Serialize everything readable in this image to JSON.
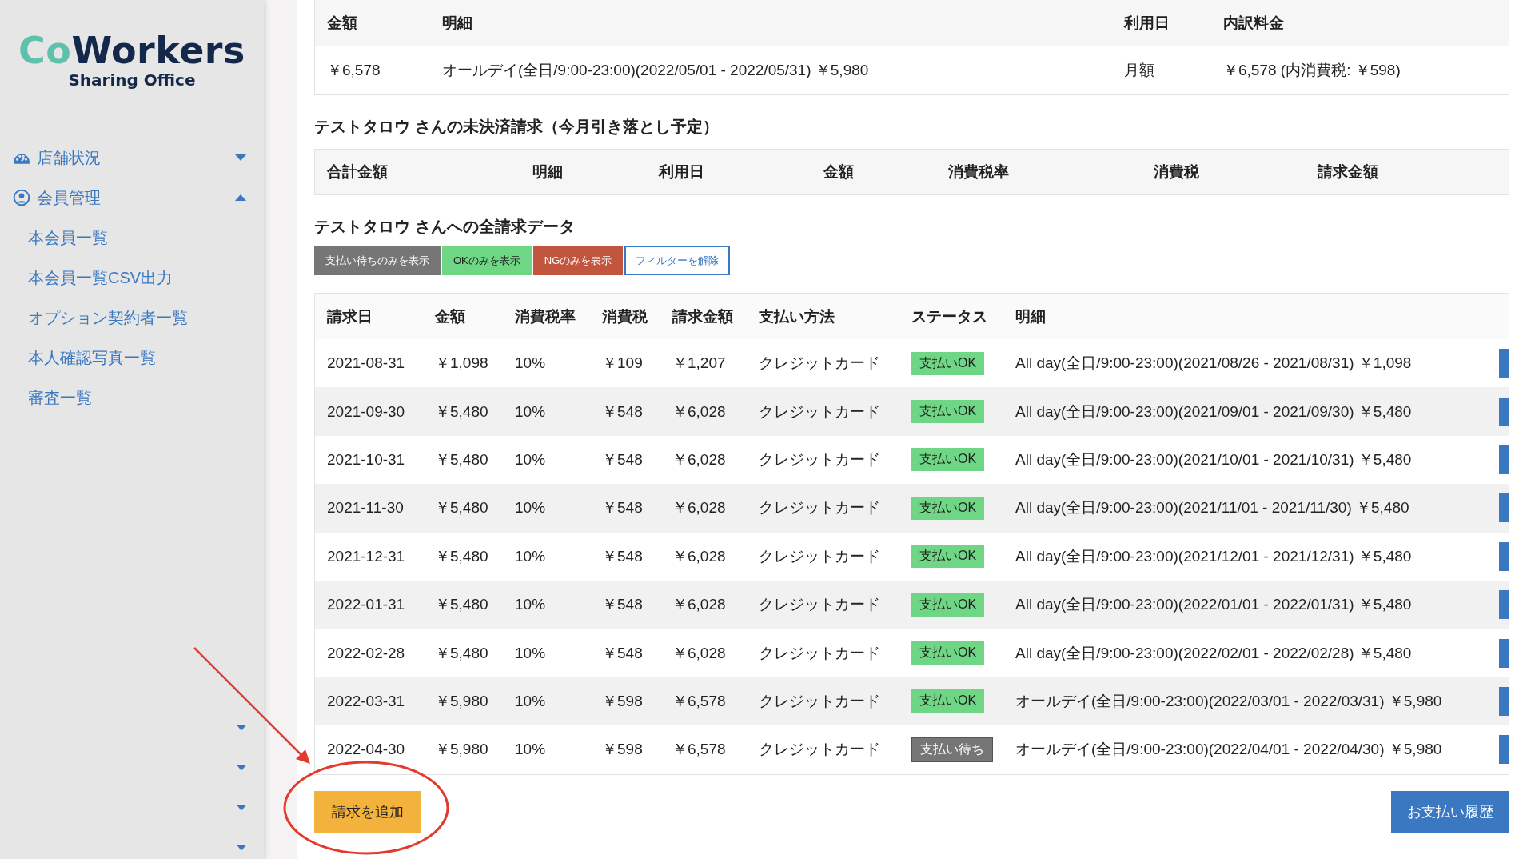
{
  "sidebar": {
    "logo": {
      "part_1": "Co",
      "part_2": "Workers",
      "subtitle": "Sharing Office"
    },
    "menus": [
      {
        "label": "店舗状況",
        "expanded": false
      },
      {
        "label": "会員管理",
        "expanded": true,
        "items": [
          "本会員一覧",
          "本会員一覧CSV出力",
          "オプション契約者一覧",
          "本人確認写真一覧",
          "審査一覧"
        ]
      }
    ]
  },
  "plan_table": {
    "columns": [
      "金額",
      "明細",
      "利用日",
      "内訳料金"
    ],
    "rows": [
      [
        "￥6,578",
        "オールデイ(全日/9:00-23:00)(2022/05/01 - 2022/05/31) ￥5,980",
        "月額",
        "￥6,578 (内消費税: ￥598)"
      ]
    ]
  },
  "unpaid_section": {
    "title": "テストタロウ さんの未決済請求（今月引き落とし予定）",
    "columns": [
      "合計金額",
      "明細",
      "利用日",
      "金額",
      "消費税率",
      "消費税",
      "請求金額"
    ]
  },
  "billing_section": {
    "title": "テストタロウ さんへの全請求データ",
    "filters": [
      {
        "label": "支払い待ちのみを表示",
        "kind": "pending"
      },
      {
        "label": "OKのみを表示",
        "kind": "ok"
      },
      {
        "label": "NGのみを表示",
        "kind": "ng"
      },
      {
        "label": "フィルターを解除",
        "kind": "clear"
      }
    ],
    "columns": [
      "請求日",
      "金額",
      "消費税率",
      "消費税",
      "請求金額",
      "支払い方法",
      "ステータス",
      "明細"
    ],
    "rows": [
      {
        "date": "2021-08-31",
        "amount": "￥1,098",
        "tax_rate": "10%",
        "tax": "￥109",
        "total": "￥1,207",
        "method": "クレジットカード",
        "status": "支払いOK",
        "kind": "ok",
        "detail": "All day(全日/9:00-23:00)(2021/08/26 - 2021/08/31) ￥1,098"
      },
      {
        "date": "2021-09-30",
        "amount": "￥5,480",
        "tax_rate": "10%",
        "tax": "￥548",
        "total": "￥6,028",
        "method": "クレジットカード",
        "status": "支払いOK",
        "kind": "ok",
        "detail": "All day(全日/9:00-23:00)(2021/09/01 - 2021/09/30) ￥5,480"
      },
      {
        "date": "2021-10-31",
        "amount": "￥5,480",
        "tax_rate": "10%",
        "tax": "￥548",
        "total": "￥6,028",
        "method": "クレジットカード",
        "status": "支払いOK",
        "kind": "ok",
        "detail": "All day(全日/9:00-23:00)(2021/10/01 - 2021/10/31) ￥5,480"
      },
      {
        "date": "2021-11-30",
        "amount": "￥5,480",
        "tax_rate": "10%",
        "tax": "￥548",
        "total": "￥6,028",
        "method": "クレジットカード",
        "status": "支払いOK",
        "kind": "ok",
        "detail": "All day(全日/9:00-23:00)(2021/11/01 - 2021/11/30) ￥5,480"
      },
      {
        "date": "2021-12-31",
        "amount": "￥5,480",
        "tax_rate": "10%",
        "tax": "￥548",
        "total": "￥6,028",
        "method": "クレジットカード",
        "status": "支払いOK",
        "kind": "ok",
        "detail": "All day(全日/9:00-23:00)(2021/12/01 - 2021/12/31) ￥5,480"
      },
      {
        "date": "2022-01-31",
        "amount": "￥5,480",
        "tax_rate": "10%",
        "tax": "￥548",
        "total": "￥6,028",
        "method": "クレジットカード",
        "status": "支払いOK",
        "kind": "ok",
        "detail": "All day(全日/9:00-23:00)(2022/01/01 - 2022/01/31) ￥5,480"
      },
      {
        "date": "2022-02-28",
        "amount": "￥5,480",
        "tax_rate": "10%",
        "tax": "￥548",
        "total": "￥6,028",
        "method": "クレジットカード",
        "status": "支払いOK",
        "kind": "ok",
        "detail": "All day(全日/9:00-23:00)(2022/02/01 - 2022/02/28) ￥5,480"
      },
      {
        "date": "2022-03-31",
        "amount": "￥5,980",
        "tax_rate": "10%",
        "tax": "￥598",
        "total": "￥6,578",
        "method": "クレジットカード",
        "status": "支払いOK",
        "kind": "ok",
        "detail": "オールデイ(全日/9:00-23:00)(2022/03/01 - 2022/03/31) ￥5,980"
      },
      {
        "date": "2022-04-30",
        "amount": "￥5,980",
        "tax_rate": "10%",
        "tax": "￥598",
        "total": "￥6,578",
        "method": "クレジットカード",
        "status": "支払い待ち",
        "kind": "pending",
        "detail": "オールデイ(全日/9:00-23:00)(2022/04/01 - 2022/04/30) ￥5,980"
      }
    ],
    "add_button": "請求を追加",
    "history_button": "お支払い履歴"
  }
}
